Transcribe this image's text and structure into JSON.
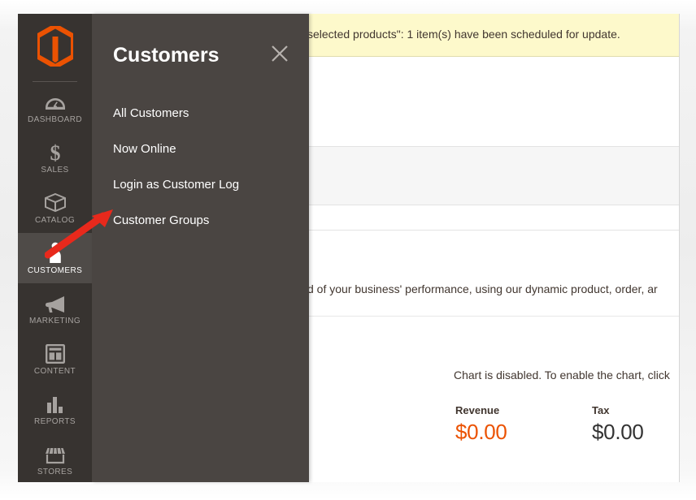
{
  "app": {
    "logo_icon": "magento-logo-icon",
    "accent_color": "#eb5202",
    "sidebar_bg": "#373330",
    "flyout_bg": "#4a4542"
  },
  "sidebar": {
    "items": [
      {
        "label": "DASHBOARD",
        "icon": "dashboard-gauge-icon",
        "active": false
      },
      {
        "label": "SALES",
        "icon": "dollar-sign-icon",
        "active": false
      },
      {
        "label": "CATALOG",
        "icon": "box-package-icon",
        "active": false
      },
      {
        "label": "CUSTOMERS",
        "icon": "person-icon",
        "active": true
      },
      {
        "label": "MARKETING",
        "icon": "megaphone-icon",
        "active": false
      },
      {
        "label": "CONTENT",
        "icon": "page-layout-icon",
        "active": false
      },
      {
        "label": "REPORTS",
        "icon": "bar-chart-icon",
        "active": false
      },
      {
        "label": "STORES",
        "icon": "storefront-icon",
        "active": false
      }
    ]
  },
  "flyout": {
    "title": "Customers",
    "close_icon": "close-x-icon",
    "items": [
      {
        "label": "All Customers"
      },
      {
        "label": "Now Online"
      },
      {
        "label": "Login as Customer Log"
      },
      {
        "label": "Customer Groups"
      }
    ]
  },
  "content": {
    "notice": "selected products\": 1 item(s) have been scheduled for update.",
    "description": "d of your business' performance, using our dynamic product, order, ar",
    "chart_disabled": "Chart is disabled. To enable the chart, click",
    "totals": [
      {
        "label": "Revenue",
        "value": "$0.00",
        "accent": true
      },
      {
        "label": "Tax",
        "value": "$0.00",
        "accent": false
      }
    ]
  },
  "annotation": {
    "type": "arrow",
    "color": "#e8291c",
    "points_to": "Customer Groups"
  }
}
